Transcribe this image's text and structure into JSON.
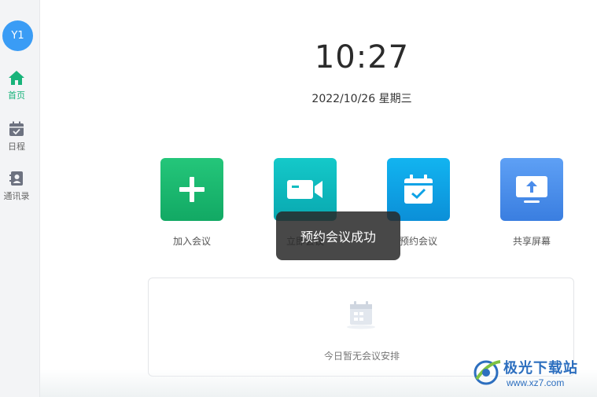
{
  "user": {
    "avatar_initials": "Y1"
  },
  "sidebar": {
    "items": [
      {
        "label": "首页",
        "icon": "home-icon",
        "active": true
      },
      {
        "label": "日程",
        "icon": "calendar-icon",
        "active": false
      },
      {
        "label": "通讯录",
        "icon": "contacts-icon",
        "active": false
      }
    ]
  },
  "clock": {
    "time": "10:27",
    "date": "2022/10/26 星期三"
  },
  "actions": [
    {
      "label": "加入会议",
      "icon": "plus-icon",
      "color": "#1bb86f"
    },
    {
      "label": "立即会议",
      "icon": "video-camera-icon",
      "color": "#10bcc0"
    },
    {
      "label": "预约会议",
      "icon": "calendar-check-icon",
      "color": "#0ea2e6"
    },
    {
      "label": "共享屏幕",
      "icon": "screen-share-icon",
      "color": "#4a8ceb"
    }
  ],
  "schedule_panel": {
    "empty_text": "今日暂无会议安排"
  },
  "toast": {
    "message": "预约会议成功"
  },
  "watermark": {
    "title": "极光下载站",
    "url": "www.xz7.com"
  }
}
